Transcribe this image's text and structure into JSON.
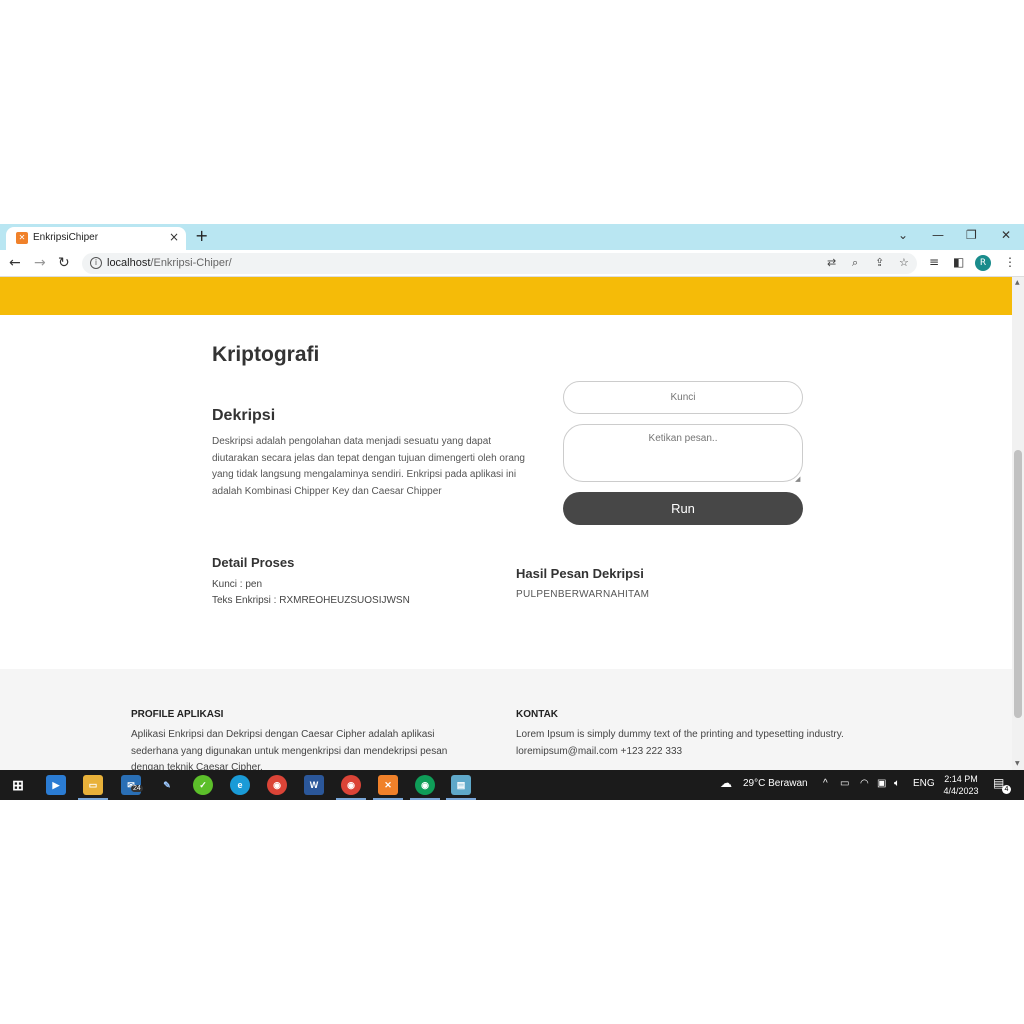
{
  "browser": {
    "tab_title": "EnkripsiChiper",
    "tab_close": "×",
    "new_tab": "+",
    "url_host": "localhost",
    "url_path": "/Enkripsi-Chiper/",
    "avatar_initial": "R"
  },
  "page": {
    "title": "Kriptografi",
    "section_title": "Dekripsi",
    "description": "Deskripsi adalah pengolahan data menjadi sesuatu yang dapat diutarakan secara jelas dan tepat dengan tujuan dimengerti oleh orang yang tidak langsung mengalaminya sendiri. Enkripsi pada aplikasi ini adalah Kombinasi Chipper Key dan Caesar Chipper",
    "form": {
      "key_placeholder": "Kunci",
      "message_placeholder": "Ketikan pesan..",
      "run_label": "Run"
    },
    "detail": {
      "title": "Detail Proses",
      "key_line": "Kunci : pen",
      "text_line": "Teks Enkripsi : RXMREOHEUZSUOSIJWSN"
    },
    "result": {
      "title": "Hasil Pesan Dekripsi",
      "value": "PULPENBERWARNAHITAM"
    },
    "footer": {
      "profile_title": "PROFILE APLIKASI",
      "profile_text_1": "Aplikasi Enkripsi dan Dekripsi dengan Caesar Cipher adalah aplikasi",
      "profile_text_2": "sederhana yang digunakan untuk mengenkripsi dan mendekripsi pesan",
      "profile_text_3": "dengan teknik Caesar Cipher.",
      "contact_title": "KONTAK",
      "contact_text": "Lorem Ipsum is simply dummy text of the printing and typesetting industry.",
      "contact_info": "loremipsum@mail.com +123 222 333"
    }
  },
  "taskbar": {
    "mail_badge": "24",
    "weather": "29°C  Berawan",
    "language": "ENG",
    "time": "2:14 PM",
    "date": "4/4/2023",
    "notification_count": "4"
  },
  "colors": {
    "accent_yellow": "#f5bb08",
    "tabbar": "#b9e6f2",
    "run_button": "#474747"
  }
}
